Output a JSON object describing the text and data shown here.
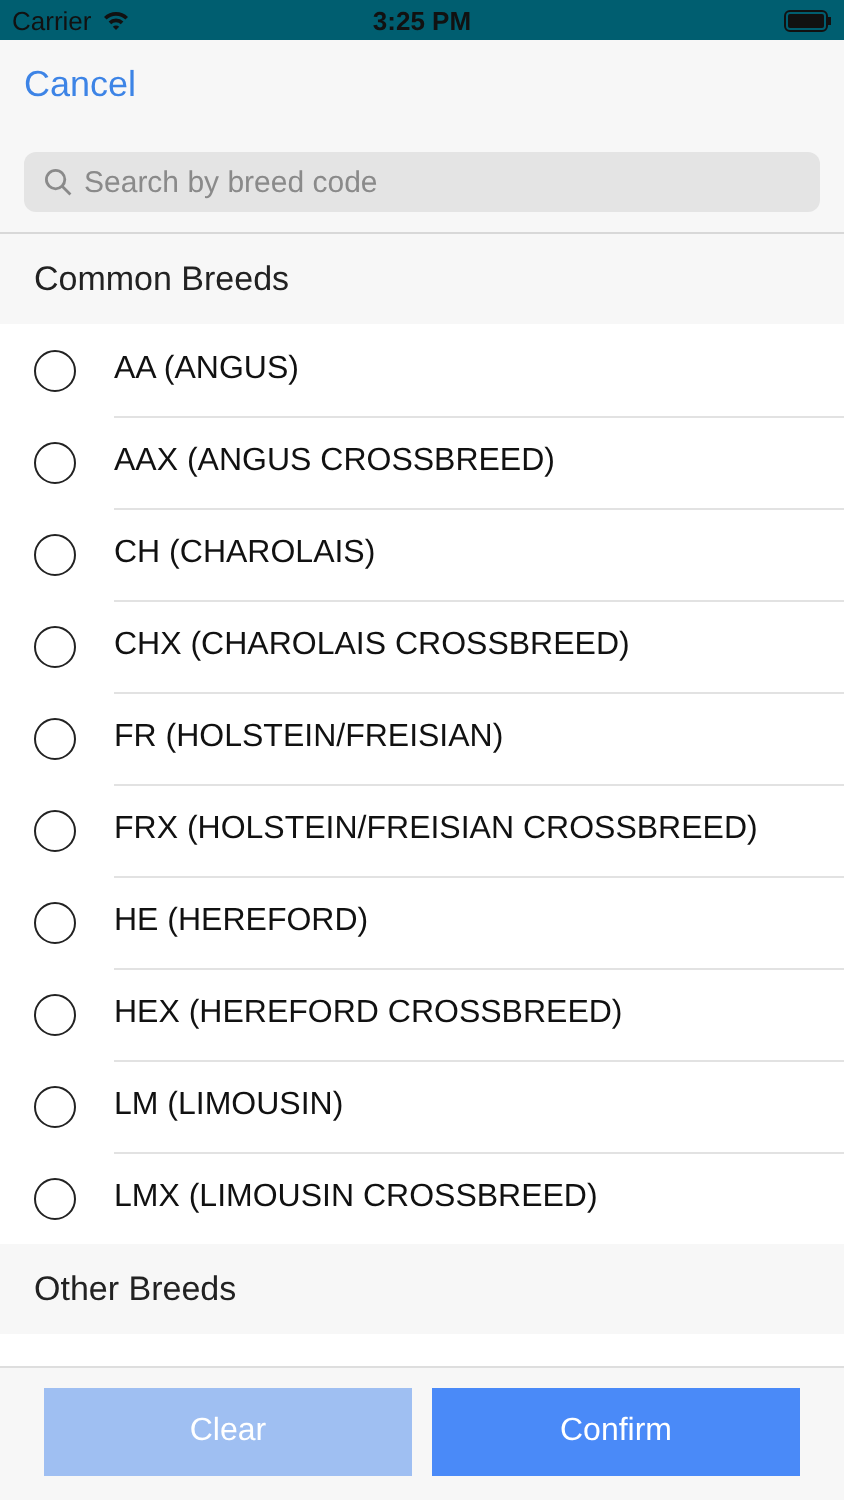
{
  "status_bar": {
    "carrier": "Carrier",
    "time": "3:25 PM"
  },
  "nav": {
    "cancel": "Cancel"
  },
  "search": {
    "placeholder": "Search by breed code"
  },
  "sections": [
    {
      "title": "Common Breeds",
      "items": [
        {
          "label": "AA (ANGUS)",
          "selected": false
        },
        {
          "label": "AAX (ANGUS CROSSBREED)",
          "selected": false
        },
        {
          "label": "CH (CHAROLAIS)",
          "selected": false
        },
        {
          "label": "CHX (CHAROLAIS CROSSBREED)",
          "selected": false
        },
        {
          "label": "FR (HOLSTEIN/FREISIAN)",
          "selected": false
        },
        {
          "label": "FRX (HOLSTEIN/FREISIAN CROSSBREED)",
          "selected": false
        },
        {
          "label": "HE (HEREFORD)",
          "selected": false
        },
        {
          "label": "HEX (HEREFORD CROSSBREED)",
          "selected": false
        },
        {
          "label": "LM (LIMOUSIN)",
          "selected": false
        },
        {
          "label": "LMX (LIMOUSIN CROSSBREED)",
          "selected": false
        }
      ]
    },
    {
      "title": "Other Breeds"
    }
  ],
  "buttons": [
    {
      "label": "Clear",
      "disabled": true
    },
    {
      "label": "Confirm",
      "disabled": false
    }
  ]
}
